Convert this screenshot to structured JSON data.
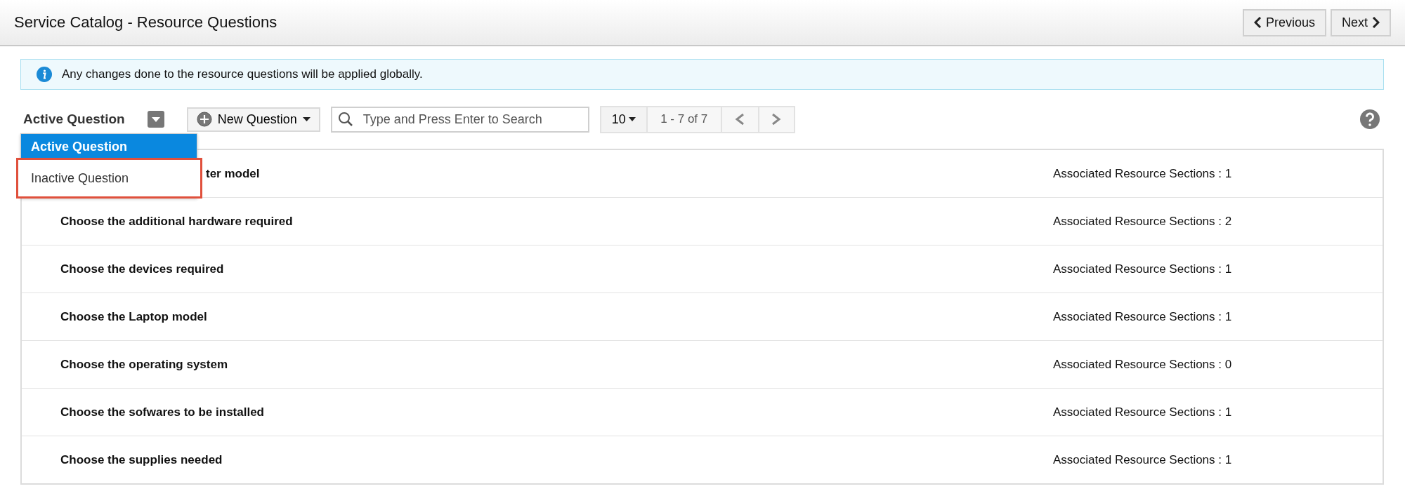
{
  "header": {
    "title": "Service Catalog - Resource Questions",
    "buttons": [
      {
        "kind": "previous",
        "label": "Previous"
      },
      {
        "kind": "next",
        "label": "Next"
      }
    ]
  },
  "notice": {
    "text": "Any changes done to the resource questions will be applied globally."
  },
  "toolbar": {
    "filter": "Active Question",
    "new_button": "New Question",
    "search": {
      "placeholder": "Type and Press Enter to Search"
    },
    "page_size": "10",
    "range": "1 - 7 of 7"
  },
  "filter_menu": {
    "items": [
      {
        "label": "Active Question",
        "selected": true,
        "highlighted": false
      },
      {
        "label": "Inactive Question",
        "selected": false,
        "highlighted": true
      }
    ]
  },
  "rows": [
    {
      "question": "ter model",
      "sections": "Associated Resource Sections : 1",
      "kind": "partial"
    },
    {
      "question": "Choose the additional hardware required",
      "sections": "Associated Resource Sections : 2",
      "kind": "full"
    },
    {
      "question": "Choose the devices required",
      "sections": "Associated Resource Sections : 1",
      "kind": "full"
    },
    {
      "question": "Choose the Laptop model",
      "sections": "Associated Resource Sections : 1",
      "kind": "full"
    },
    {
      "question": "Choose the operating system",
      "sections": "Associated Resource Sections : 0",
      "kind": "full"
    },
    {
      "question": "Choose the sofwares to be installed",
      "sections": "Associated Resource Sections : 1",
      "kind": "full"
    },
    {
      "question": "Choose the supplies needed",
      "sections": "Associated Resource Sections : 1",
      "kind": "full"
    }
  ]
}
